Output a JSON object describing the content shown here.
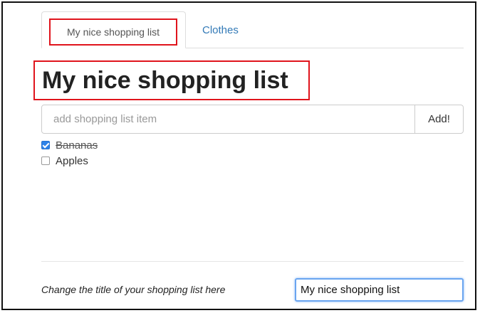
{
  "tabs": [
    {
      "label": "My nice shopping list",
      "active": true
    },
    {
      "label": "Clothes",
      "active": false
    }
  ],
  "page_title": "My nice shopping list",
  "add_item": {
    "placeholder": "add shopping list item",
    "value": "",
    "button_label": "Add!"
  },
  "items": [
    {
      "label": "Bananas",
      "checked": true
    },
    {
      "label": "Apples",
      "checked": false
    }
  ],
  "footer": {
    "label": "Change the title of your shopping list here",
    "title_input_value": "My nice shopping list"
  },
  "colors": {
    "highlight": "#e0141c",
    "link": "#337ab7",
    "checkbox": "#2e82e8",
    "focus": "#6aa5f0"
  }
}
